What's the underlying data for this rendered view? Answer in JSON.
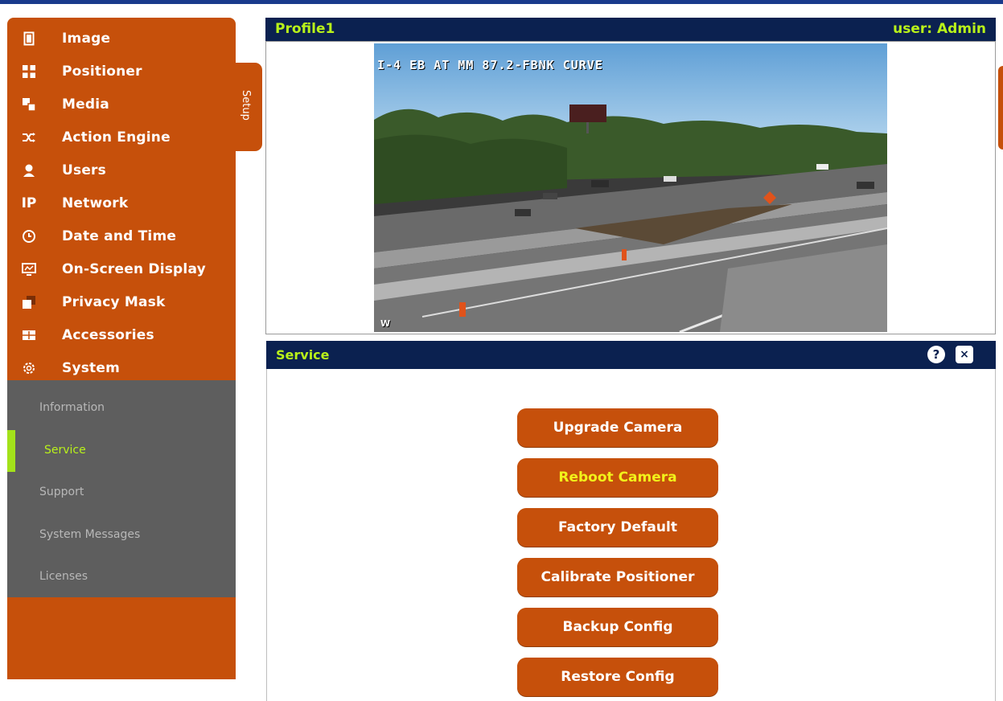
{
  "sidebar": {
    "items": [
      {
        "label": "Image",
        "icon": "image-icon"
      },
      {
        "label": "Positioner",
        "icon": "positioner-icon"
      },
      {
        "label": "Media",
        "icon": "media-icon"
      },
      {
        "label": "Action Engine",
        "icon": "shuffle-icon"
      },
      {
        "label": "Users",
        "icon": "user-icon"
      },
      {
        "label": "Network",
        "icon": "ip-icon"
      },
      {
        "label": "Date and Time",
        "icon": "clock-icon"
      },
      {
        "label": "On-Screen Display",
        "icon": "monitor-icon"
      },
      {
        "label": "Privacy Mask",
        "icon": "mask-icon"
      },
      {
        "label": "Accessories",
        "icon": "accessories-icon"
      },
      {
        "label": "System",
        "icon": "gear-icon"
      }
    ],
    "submenu": [
      {
        "label": "Information"
      },
      {
        "label": "Service",
        "active": true
      },
      {
        "label": "Support"
      },
      {
        "label": "System Messages"
      },
      {
        "label": "Licenses"
      }
    ],
    "setup_tab": "Setup"
  },
  "video": {
    "profile": "Profile1",
    "user": "user: Admin",
    "overlay_text": "I-4 EB AT MM 87.2-FBNK CURVE",
    "corner_mark": "W"
  },
  "service": {
    "title": "Service",
    "help_symbol": "?",
    "close_symbol": "×",
    "buttons": [
      {
        "label": "Upgrade Camera"
      },
      {
        "label": "Reboot Camera",
        "highlight": true
      },
      {
        "label": "Factory Default"
      },
      {
        "label": "Calibrate Positioner"
      },
      {
        "label": "Backup Config"
      },
      {
        "label": "Restore Config"
      }
    ]
  },
  "colors": {
    "accent_orange": "#c6500b",
    "header_navy": "#0b2150",
    "lime": "#b9f21a",
    "submenu_gray": "#5e5e5e"
  }
}
